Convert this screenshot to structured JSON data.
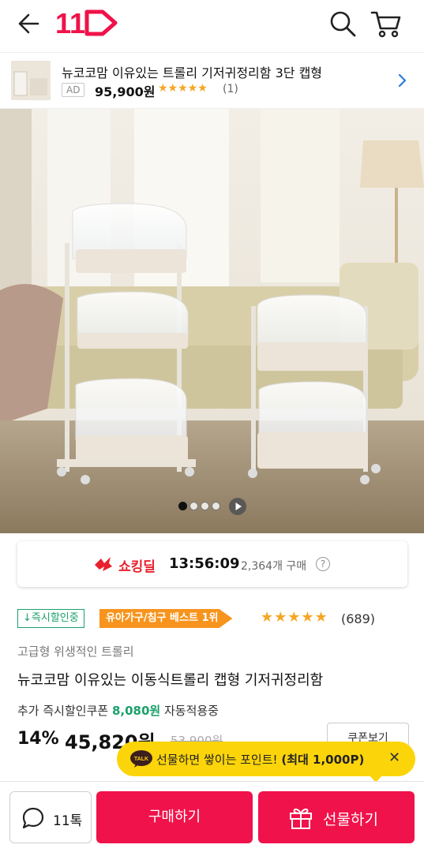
{
  "header": {
    "back_icon": "arrow-left-icon",
    "logo_text": "11",
    "search_icon": "search-icon",
    "cart_icon": "cart-icon"
  },
  "ad": {
    "title": "뉴코코맘 이유있는 트롤리 기저귀정리함 3단 캡형",
    "badge": "AD",
    "price": "95,900원",
    "stars": "★★★★★",
    "review_count": "(1)"
  },
  "gallery": {
    "image_count": 4,
    "active_index": 0
  },
  "deal": {
    "label": "쇼킹딜",
    "timer": "13:56:09",
    "sold": "2,364개 구매",
    "help": "?"
  },
  "badges": {
    "instant_discount": "↓즉시할인중",
    "best": "유아가구/침구 베스트 1위"
  },
  "rating": {
    "stars": "★★★★★",
    "value": 4.5,
    "count": "(689)"
  },
  "product": {
    "subtitle": "고급형 위생적인 트롤리",
    "title": "뉴코코맘 이유있는 이동식트롤리 캡형 기저귀정리함"
  },
  "pricing": {
    "coupon_prefix": "추가 즉시할인쿠폰",
    "coupon_amount": "8,080원",
    "coupon_suffix": "자동적용중",
    "discount": "14%",
    "price": "45,820원",
    "original_price": "53,900원",
    "coupon_button": "쿠폰보기"
  },
  "gift_tip": {
    "icon": "TALK",
    "text": "선물하면 쌓이는 포인트!",
    "highlight": "(최대 1,000P)",
    "close": "✕"
  },
  "bottom": {
    "talk_label": "11톡",
    "buy_label": "구매하기",
    "gift_label": "선물하기"
  },
  "colors": {
    "brand": "#f0124a",
    "deal_red": "#e8212d",
    "green": "#1aa06b",
    "orange": "#f7941d",
    "yellow": "#fcd40a",
    "star": "#f5a623"
  }
}
